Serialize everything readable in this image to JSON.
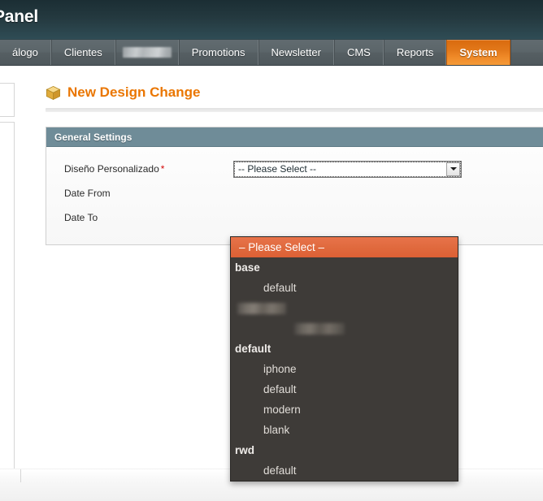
{
  "header": {
    "title": "Panel"
  },
  "nav": {
    "tabs": [
      {
        "label": "álogo",
        "state": "normal",
        "name": "nav-tab-catalog"
      },
      {
        "label": "Clientes",
        "state": "normal",
        "name": "nav-tab-clientes"
      },
      {
        "label": "",
        "state": "redacted",
        "name": "nav-tab-redacted"
      },
      {
        "label": "Promotions",
        "state": "normal",
        "name": "nav-tab-promotions"
      },
      {
        "label": "Newsletter",
        "state": "normal",
        "name": "nav-tab-newsletter"
      },
      {
        "label": "CMS",
        "state": "normal",
        "name": "nav-tab-cms"
      },
      {
        "label": "Reports",
        "state": "normal",
        "name": "nav-tab-reports"
      },
      {
        "label": "System",
        "state": "active",
        "name": "nav-tab-system"
      }
    ]
  },
  "page": {
    "title": "New Design Change",
    "title_icon": "box-package-icon"
  },
  "fieldset": {
    "legend": "General Settings",
    "rows": [
      {
        "label": "Diseño Personalizado",
        "required": true,
        "name": "field-custom-design"
      },
      {
        "label": "Date From",
        "required": false,
        "name": "field-date-from"
      },
      {
        "label": "Date To",
        "required": false,
        "name": "field-date-to"
      }
    ]
  },
  "select": {
    "value": "-- Please Select --",
    "expanded": true,
    "arrow_icon": "chevron-down-icon",
    "options": [
      {
        "label": "-- Please Select --",
        "type": "option",
        "indent": false,
        "selected": true
      },
      {
        "label": "base",
        "type": "group",
        "indent": false,
        "selected": false
      },
      {
        "label": "default",
        "type": "option",
        "indent": true,
        "selected": false
      },
      {
        "label": "",
        "type": "group",
        "indent": false,
        "selected": false,
        "redacted": true
      },
      {
        "label": "",
        "type": "option",
        "indent": true,
        "selected": false,
        "redacted": true
      },
      {
        "label": "default",
        "type": "group",
        "indent": false,
        "selected": false
      },
      {
        "label": "iphone",
        "type": "option",
        "indent": true,
        "selected": false
      },
      {
        "label": "default",
        "type": "option",
        "indent": true,
        "selected": false
      },
      {
        "label": "modern",
        "type": "option",
        "indent": true,
        "selected": false
      },
      {
        "label": "blank",
        "type": "option",
        "indent": true,
        "selected": false
      },
      {
        "label": "rwd",
        "type": "group",
        "indent": false,
        "selected": false
      },
      {
        "label": "default",
        "type": "option",
        "indent": true,
        "selected": false
      }
    ]
  },
  "colors": {
    "header_dark": "#24393f",
    "nav_bar": "#575f63",
    "accent_orange": "#ea7601",
    "active_tab_orange": "#f08a28",
    "fieldset_head": "#6f8c98",
    "dropdown_bg": "#3e3b38",
    "dropdown_selected": "#e06a3e",
    "required_red": "#d40707"
  }
}
